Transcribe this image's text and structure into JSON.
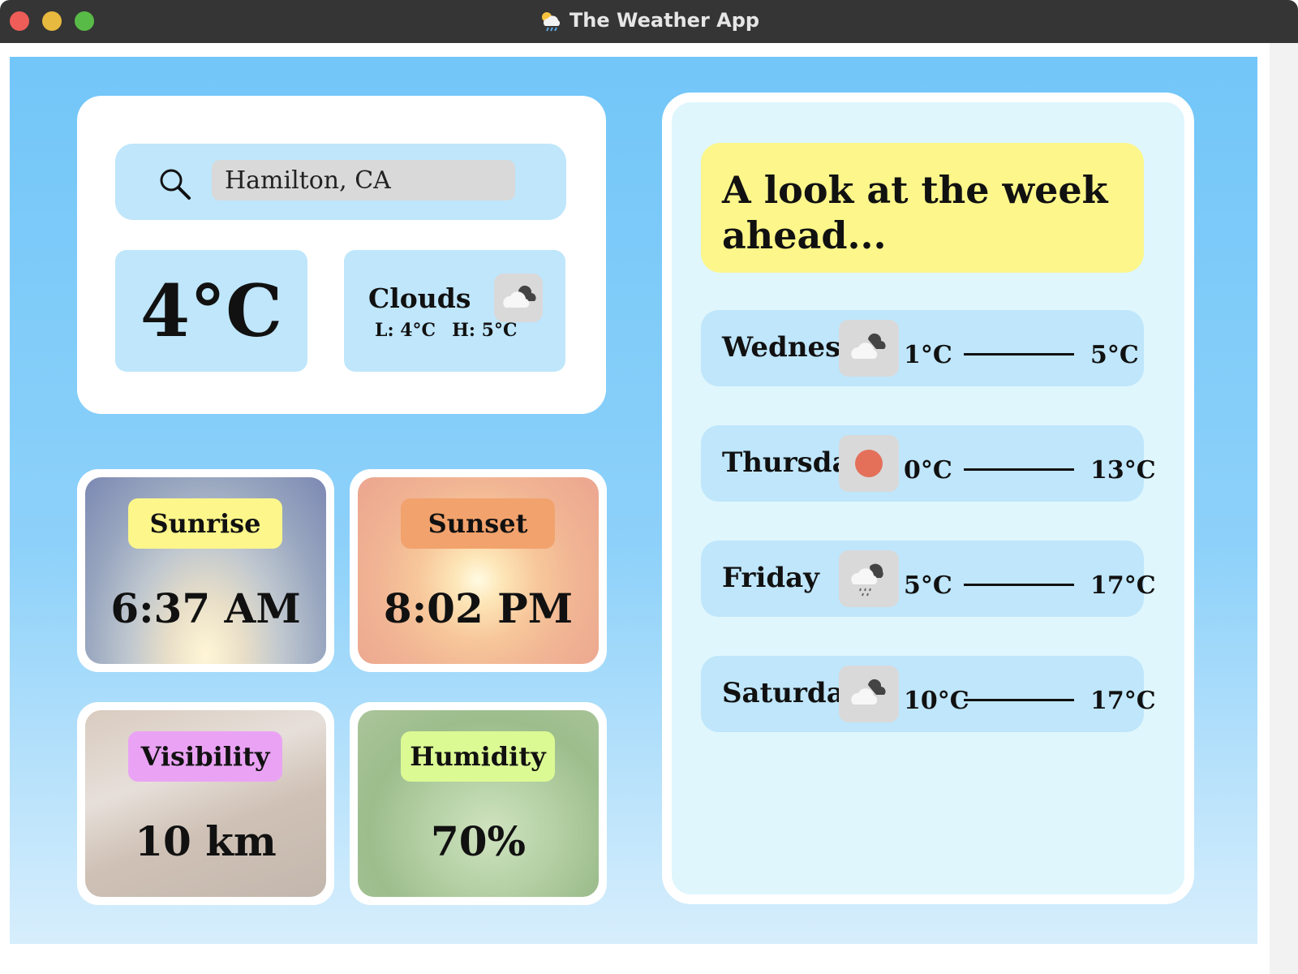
{
  "window": {
    "title": "The Weather App"
  },
  "search": {
    "value": "Hamilton, CA"
  },
  "current": {
    "temperature": "4°C",
    "condition": "Clouds",
    "low": "L: 4°C",
    "high": "H: 5°C",
    "icon": "cloud-icon"
  },
  "stats": {
    "sunrise": {
      "label": "Sunrise",
      "value": "6:37 AM",
      "color": "#fcf68b"
    },
    "sunset": {
      "label": "Sunset",
      "value": "8:02 PM",
      "color": "#f2a26c"
    },
    "visibility": {
      "label": "Visibility",
      "value": "10 km",
      "color": "#eaa3f4"
    },
    "humidity": {
      "label": "Humidity",
      "value": "70%",
      "color": "#dcfa94"
    }
  },
  "week": {
    "title": "A look at the week ahead...",
    "days": [
      {
        "name": "Wednesday",
        "icon": "cloud-icon",
        "low": "1°C",
        "high": "5°C"
      },
      {
        "name": "Thursday",
        "icon": "sun-icon",
        "low": "0°C",
        "high": "13°C"
      },
      {
        "name": "Friday",
        "icon": "rain-cloud-icon",
        "low": "5°C",
        "high": "17°C"
      },
      {
        "name": "Saturday",
        "icon": "cloud-icon",
        "low": "10°C",
        "high": "17°C"
      }
    ]
  },
  "colors": {
    "background": "#72c6f8",
    "panel": "#bfe6fb",
    "accent_yellow": "#fcf68b"
  }
}
